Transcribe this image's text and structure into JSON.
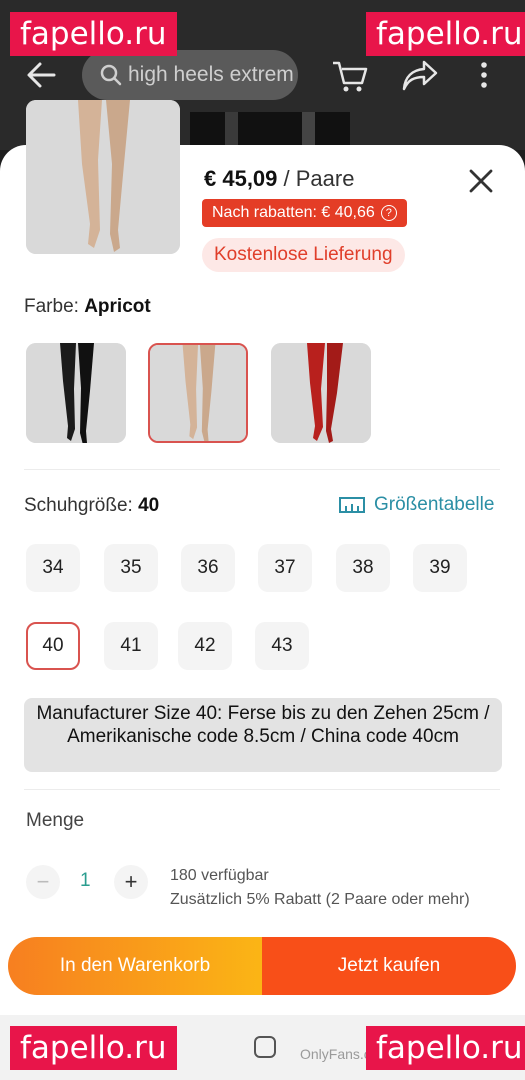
{
  "search": {
    "query": "high heels extrem"
  },
  "product": {
    "price": "€ 45,09",
    "unit": " / Paare",
    "discount_label": "Nach rabatten: € 40,66",
    "discount_info_icon": "info-icon",
    "shipping_label": "Kostenlose Lieferung"
  },
  "color": {
    "label": "Farbe: ",
    "selected": "Apricot",
    "options": [
      "black",
      "apricot",
      "red"
    ],
    "option_colors": [
      "#1b1b1b",
      "#d4b398",
      "#b8201d"
    ]
  },
  "size": {
    "label": "Schuhgröße: ",
    "selected": "40",
    "chart_label": "Größentabelle",
    "options": [
      "34",
      "35",
      "36",
      "37",
      "38",
      "39",
      "40",
      "41",
      "42",
      "43"
    ],
    "note": "Manufacturer Size 40: Ferse bis zu den Zehen 25cm / Amerikanische code 8.5cm / China code 40cm"
  },
  "quantity": {
    "label": "Menge",
    "value": "1",
    "minus": "−",
    "plus": "+",
    "available": "180 verfügbar",
    "bulk_discount": "Zusätzlich 5% Rabatt (2 Paare oder mehr)"
  },
  "actions": {
    "add_to_cart": "In den Warenkorb",
    "buy_now": "Jetzt kaufen"
  },
  "watermarks": {
    "text": "fapello.ru",
    "footer_text": "OnlyFans.com/valentina.uvida"
  },
  "colors": {
    "accent_red": "#e43d26",
    "buy_orange": "#f84f18",
    "cart_gradient_start": "#f77f20",
    "cart_gradient_end": "#fbb515",
    "link_teal": "#2b8fa5"
  }
}
